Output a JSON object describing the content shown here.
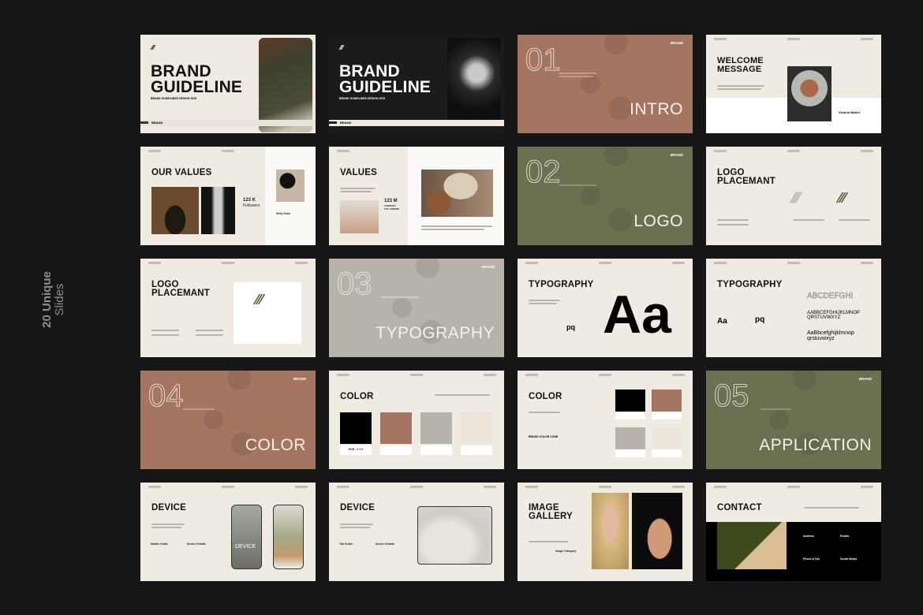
{
  "side_label": [
    "20 Unique",
    "Slides"
  ],
  "colors": {
    "background": "#161616",
    "cream": "#efebe3",
    "brown": "#a47561",
    "olive": "#6b7150",
    "gray": "#b7b2aa",
    "black": "#000000"
  },
  "slides": {
    "cover_light": {
      "title1": "BRAND",
      "title2": "GUIDELINE",
      "subtitle": "BRAND GUIDELINES DESIGN 2025",
      "footer": "BRAND"
    },
    "cover_dark": {
      "title1": "BRAND",
      "title2": "GUIDELINE",
      "subtitle": "BRAND GUIDELINES DESIGN 2025",
      "footer": "BRAND"
    },
    "intro": {
      "number": "01",
      "word": "INTRO",
      "brand": "BRAND"
    },
    "welcome": {
      "title1": "WELCOME",
      "title2": "MESSAGE",
      "name": "Victoria Walker"
    },
    "our_values": {
      "title": "OUR VALUES",
      "stat": "123 K",
      "stat_label": "Followers",
      "name": "Nelly Dean"
    },
    "values": {
      "title": "VALUES",
      "stat": "123 M",
      "stat_label": "COMPANY FOLLOWERS"
    },
    "logo": {
      "number": "02",
      "word": "LOGO",
      "brand": "BRAND"
    },
    "logo_placement_1": {
      "title1": "LOGO",
      "title2": "PLACEMANT"
    },
    "logo_placement_2": {
      "title1": "LOGO",
      "title2": "PLACEMANT"
    },
    "typography_section": {
      "number": "03",
      "word": "TYPOGRAPHY",
      "brand": "BRAND"
    },
    "typography_1": {
      "title": "TYPOGRAPHY",
      "big": "Aa",
      "small": "pq"
    },
    "typography_2": {
      "title": "TYPOGRAPHY",
      "sample1": "Aa",
      "sample2": "pq",
      "outline": "ABCDEFGHI",
      "upper": "AABBCEFGHIJKLMNOP QRSTUVWXYZ",
      "lower": "AaBbcefghijklmnop qrstuvwxyz"
    },
    "color_section": {
      "number": "04",
      "word": "COLOR",
      "brand": "BRAND"
    },
    "color_1": {
      "title": "COLOR",
      "swatches": [
        "#000000",
        "#a47561",
        "#b7b2aa",
        "#ece6dc"
      ],
      "swatch_label": "RGB : 0 0 0"
    },
    "color_2": {
      "title": "COLOR",
      "subtitle": "BRAND COLOR CODE",
      "swatches": [
        "#000000",
        "#a47561",
        "#b7b2aa",
        "#ece6dc"
      ]
    },
    "application": {
      "number": "05",
      "word": "APPLICATION",
      "brand": "BRAND"
    },
    "device_mobile": {
      "title": "DEVICE",
      "col1": "Mobile Guide",
      "col2": "Device Details",
      "phone_text": "DEVICE"
    },
    "device_tab": {
      "title": "DEVICE",
      "col1": "Tab Guide",
      "col2": "Device Details"
    },
    "gallery": {
      "title1": "IMAGE",
      "title2": "GALLERY",
      "category": "Image Category"
    },
    "contact": {
      "title": "CONTACT",
      "address": "Address",
      "emails": "Emails",
      "phone": "Phone & Fax",
      "social": "Social Media"
    }
  }
}
